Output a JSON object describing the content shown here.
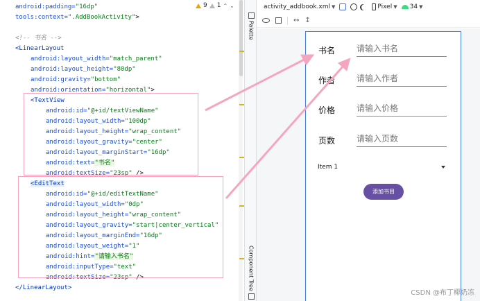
{
  "editor": {
    "line_height": 15,
    "lines": [
      [
        {
          "c": "attr",
          "t": "android:padding="
        },
        {
          "c": "val",
          "t": "\"16dp\""
        }
      ],
      [
        {
          "c": "attr",
          "t": "tools:context="
        },
        {
          "c": "val",
          "t": "\".AddBookActivity\""
        },
        {
          "c": "plain",
          "t": ">"
        }
      ],
      [],
      [
        {
          "c": "com",
          "t": "<!-- 书名 -->"
        }
      ],
      [
        {
          "c": "tag",
          "t": "<LinearLayout"
        }
      ],
      [
        {
          "c": "attr",
          "t": "android:layout_width="
        },
        {
          "c": "val",
          "t": "\"match_parent\""
        }
      ],
      [
        {
          "c": "attr",
          "t": "android:layout_height="
        },
        {
          "c": "val",
          "t": "\"80dp\""
        }
      ],
      [
        {
          "c": "attr",
          "t": "android:gravity="
        },
        {
          "c": "val",
          "t": "\"bottom\""
        }
      ],
      [
        {
          "c": "attr",
          "t": "android:orientation="
        },
        {
          "c": "val",
          "t": "\"horizontal\""
        },
        {
          "c": "plain",
          "t": ">"
        }
      ],
      [
        {
          "c": "tag",
          "t": "<TextView"
        }
      ],
      [
        {
          "c": "attr",
          "t": "android:id="
        },
        {
          "c": "val",
          "t": "\"@+id/textViewName\""
        }
      ],
      [
        {
          "c": "attr",
          "t": "android:layout_width="
        },
        {
          "c": "val",
          "t": "\"100dp\""
        }
      ],
      [
        {
          "c": "attr",
          "t": "android:layout_height="
        },
        {
          "c": "val",
          "t": "\"wrap_content\""
        }
      ],
      [
        {
          "c": "attr",
          "t": "android:layout_gravity="
        },
        {
          "c": "val",
          "t": "\"center\""
        }
      ],
      [
        {
          "c": "attr",
          "t": "android:layout_marginStart="
        },
        {
          "c": "val",
          "t": "\"16dp\""
        }
      ],
      [
        {
          "c": "attr",
          "t": "android:text="
        },
        {
          "c": "val",
          "t": "\"书名\"",
          "h": true
        }
      ],
      [
        {
          "c": "attr",
          "t": "android:textSize="
        },
        {
          "c": "val",
          "t": "\"23sp\""
        },
        {
          "c": "plain",
          "t": " />"
        }
      ],
      [
        {
          "c": "tag",
          "t": "<EditText",
          "h": true
        }
      ],
      [
        {
          "c": "attr",
          "t": "android:id="
        },
        {
          "c": "val",
          "t": "\"@+id/editTextName\""
        }
      ],
      [
        {
          "c": "attr",
          "t": "android:layout_width="
        },
        {
          "c": "val",
          "t": "\"0dp\""
        }
      ],
      [
        {
          "c": "attr",
          "t": "android:layout_height="
        },
        {
          "c": "val",
          "t": "\"wrap_content\""
        }
      ],
      [
        {
          "c": "attr",
          "t": "android:layout_gravity="
        },
        {
          "c": "val",
          "t": "\"start|center_vertical\""
        }
      ],
      [
        {
          "c": "attr",
          "t": "android:layout_marginEnd="
        },
        {
          "c": "val",
          "t": "\"16dp\""
        }
      ],
      [
        {
          "c": "attr",
          "t": "android:layout_weight="
        },
        {
          "c": "val",
          "t": "\"1\""
        }
      ],
      [
        {
          "c": "attr",
          "t": "android:hint="
        },
        {
          "c": "val",
          "t": "\"请输入书名\"",
          "h": true
        }
      ],
      [
        {
          "c": "attr",
          "t": "android:inputType="
        },
        {
          "c": "val",
          "t": "\"text\""
        }
      ],
      [
        {
          "c": "attr",
          "t": "android:textSize="
        },
        {
          "c": "val",
          "t": "\"23sp\""
        },
        {
          "c": "plain",
          "t": " />"
        }
      ],
      [
        {
          "c": "tag",
          "t": "</LinearLayout>"
        }
      ]
    ],
    "indents": [
      22,
      22,
      0,
      22,
      22,
      44,
      44,
      44,
      44,
      44,
      66,
      66,
      66,
      66,
      66,
      66,
      66,
      44,
      66,
      66,
      66,
      66,
      66,
      66,
      66,
      66,
      66,
      22
    ],
    "inspection": {
      "warnings": "9",
      "weak_warnings": "1"
    }
  },
  "side_tabs": {
    "palette": "Palette",
    "component_tree": "Component Tree"
  },
  "toolbar": {
    "file_name": "activity_addbook.xml",
    "device": "Pixel",
    "api_level": "34"
  },
  "form": {
    "rows": [
      {
        "label": "书名",
        "hint": "请输入书名"
      },
      {
        "label": "作者",
        "hint": "请输入作者"
      },
      {
        "label": "价格",
        "hint": "请输入价格"
      },
      {
        "label": "页数",
        "hint": "请输入页数"
      }
    ],
    "spinner_value": "Item 1",
    "button_label": "添加书目"
  },
  "watermark": "CSDN @布丁椰奶冻",
  "colors": {
    "accent": "#6750a4",
    "selection": "#3f7be0",
    "annotation": "#f4a6c0"
  }
}
